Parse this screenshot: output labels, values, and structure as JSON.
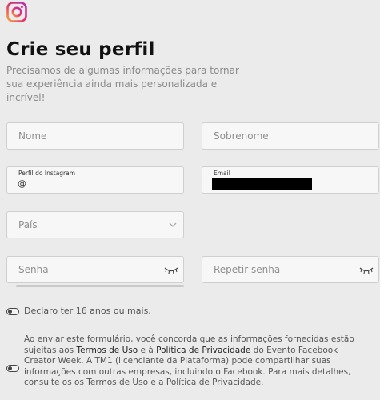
{
  "header": {
    "logo_icon": "instagram-logo-icon",
    "title": "Crie seu perfil",
    "subtitle": "Precisamos de algumas informações para tornar sua experiência ainda mais personalizada e incrível!"
  },
  "form": {
    "first_name": {
      "placeholder": "Nome"
    },
    "last_name": {
      "placeholder": "Sobrenome"
    },
    "instagram": {
      "label": "Perfil do Instagram",
      "value": "@"
    },
    "email": {
      "label": "Email"
    },
    "country": {
      "placeholder": "País",
      "icon": "chevron-down-icon"
    },
    "password": {
      "placeholder": "Senha",
      "icon": "eye-closed-icon"
    },
    "repeat_password": {
      "placeholder": "Repetir senha",
      "icon": "eye-closed-icon"
    }
  },
  "age_check": {
    "label": "Declaro ter 16 anos ou mais."
  },
  "terms": {
    "text_1": "Ao enviar este formulário, você concorda que as informações fornecidas estão sujeitas aos ",
    "link_terms": "Termos de Uso",
    "text_2": " e à ",
    "link_privacy": "Política de Privacidade",
    "text_3": " do Evento Facebook Creator Week. A TM1 (licenciante da Plataforma) pode compartilhar suas informações com outras empresas, incluindo o Facebook. Para mais detalhes, consulte os os Termos de Uso e a Política de Privacidade."
  },
  "colors": {
    "background": "#ebebeb",
    "field_background": "#f7f7f7",
    "field_border": "#cfcfcf"
  }
}
